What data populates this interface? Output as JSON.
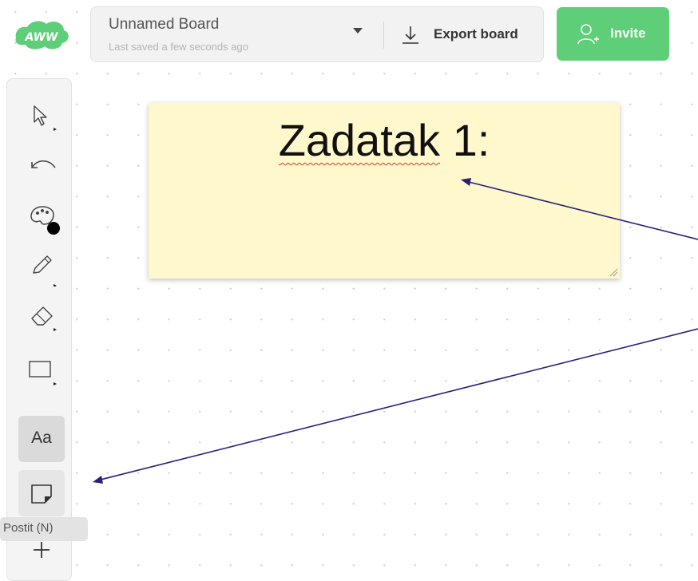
{
  "logo": {
    "text": "AWW",
    "color": "#5fce78"
  },
  "topbar": {
    "board_name": "Unnamed Board",
    "status": "Last saved a few seconds ago",
    "export_label": "Export board",
    "invite_label": "Invite"
  },
  "toolbar": {
    "tools": [
      {
        "name": "select",
        "icon": "cursor-arrow-icon"
      },
      {
        "name": "undo",
        "icon": "undo-icon"
      },
      {
        "name": "color",
        "icon": "palette-icon",
        "color": "#000000"
      },
      {
        "name": "pen",
        "icon": "pencil-icon"
      },
      {
        "name": "eraser",
        "icon": "eraser-icon"
      },
      {
        "name": "shape",
        "icon": "rectangle-icon"
      },
      {
        "name": "text",
        "label": "Aa",
        "active": true
      },
      {
        "name": "postit",
        "icon": "sticky-note-icon"
      },
      {
        "name": "more",
        "icon": "plus-icon"
      }
    ],
    "tooltip": "Postit (N)"
  },
  "postit": {
    "word1": "Zadatak",
    "word2": " 1:",
    "color": "#fff8cc"
  },
  "colors": {
    "accent": "#5fce78",
    "annotation": "#2b1f7a"
  }
}
